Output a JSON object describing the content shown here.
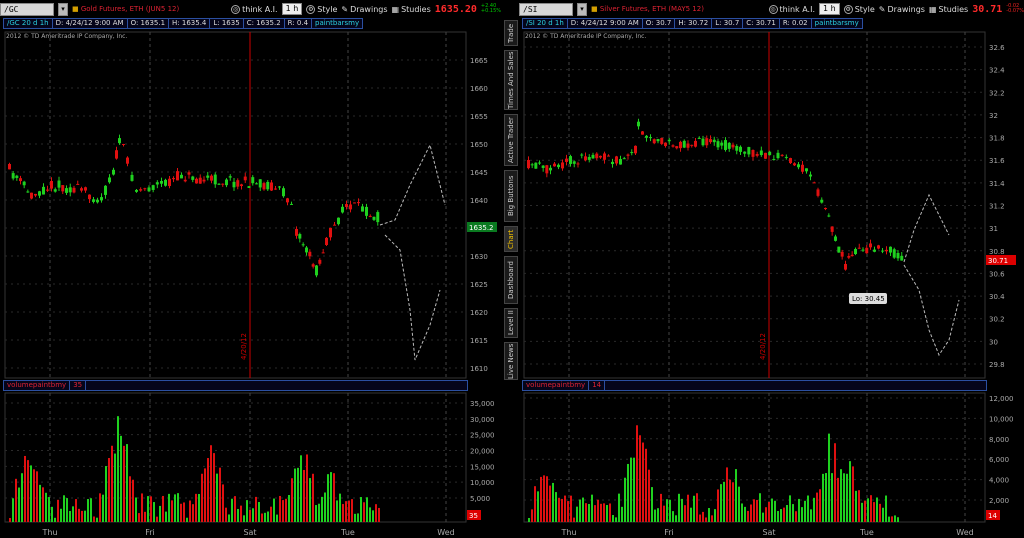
{
  "left": {
    "symbol": "/GC",
    "description": "Gold Futures, ETH (JUN5 12)",
    "price": "1635.20",
    "change_top": "+2.40",
    "change_bottom": "+0.15%",
    "ohlc": [
      "/GC 20 d 1h",
      "D: 4/24/12 9:00 AM",
      "O: 1635.1",
      "H: 1635.4",
      "L: 1635",
      "C: 1635.2",
      "R: 0.4",
      "paintbarsmy"
    ],
    "copyright": "2012 © TD Ameritrade IP Company, Inc.",
    "volume_label": "volumepaintbmy",
    "volume_value": "35",
    "last_price_tag": "1635.2",
    "volume_tag": "35",
    "date_marker": "4/20/12",
    "price_ticks": [
      "1665",
      "1660",
      "1655",
      "1650",
      "1645",
      "1640",
      "1635",
      "1630",
      "1625",
      "1620",
      "1615",
      "1610"
    ],
    "volume_ticks": [
      "35,000",
      "30,000",
      "25,000",
      "20,000",
      "15,000",
      "10,000",
      "5,000"
    ],
    "x_ticks": [
      "Thu",
      "Fri",
      "Sat",
      "Tue",
      "Wed"
    ]
  },
  "right": {
    "symbol": "/SI",
    "description": "Silver Futures, ETH (MAY5 12)",
    "price": "30.71",
    "change_top": "-0.02",
    "change_bottom": "-0.07%",
    "ohlc": [
      "/SI 20 d 1h",
      "D: 4/24/12 9:00 AM",
      "O: 30.7",
      "H: 30.72",
      "L: 30.7",
      "C: 30.71",
      "R: 0.02",
      "paintbarsmy"
    ],
    "copyright": "2012 © TD Ameritrade IP Company, Inc.",
    "volume_label": "volumepaintbmy",
    "volume_value": "14",
    "last_price_tag": "30.71",
    "volume_tag": "14",
    "date_marker": "4/20/12",
    "low_label": "Lo: 30.45",
    "price_ticks": [
      "32.6",
      "32.4",
      "32.2",
      "32",
      "31.8",
      "31.6",
      "31.4",
      "31.2",
      "31",
      "30.8",
      "30.6",
      "30.4",
      "30.2",
      "30",
      "29.8"
    ],
    "volume_ticks": [
      "12,000",
      "10,000",
      "8,000",
      "6,000",
      "4,000",
      "2,000"
    ],
    "x_ticks": [
      "Thu",
      "Fri",
      "Sat",
      "Tue",
      "Wed"
    ]
  },
  "toolbar": {
    "think": "think A.I.",
    "timeframe": "1 h",
    "style": "Style",
    "drawings": "Drawings",
    "studies": "Studies"
  },
  "side_tabs": [
    "Trade",
    "Times And Sales",
    "Active Trader",
    "Big Buttons",
    "Chart",
    "Dashboard",
    "Level II",
    "Live News"
  ],
  "colors": {
    "up": "#1fd11f",
    "down": "#e01010",
    "grid": "#444",
    "accent": "#2ad0e0"
  }
}
